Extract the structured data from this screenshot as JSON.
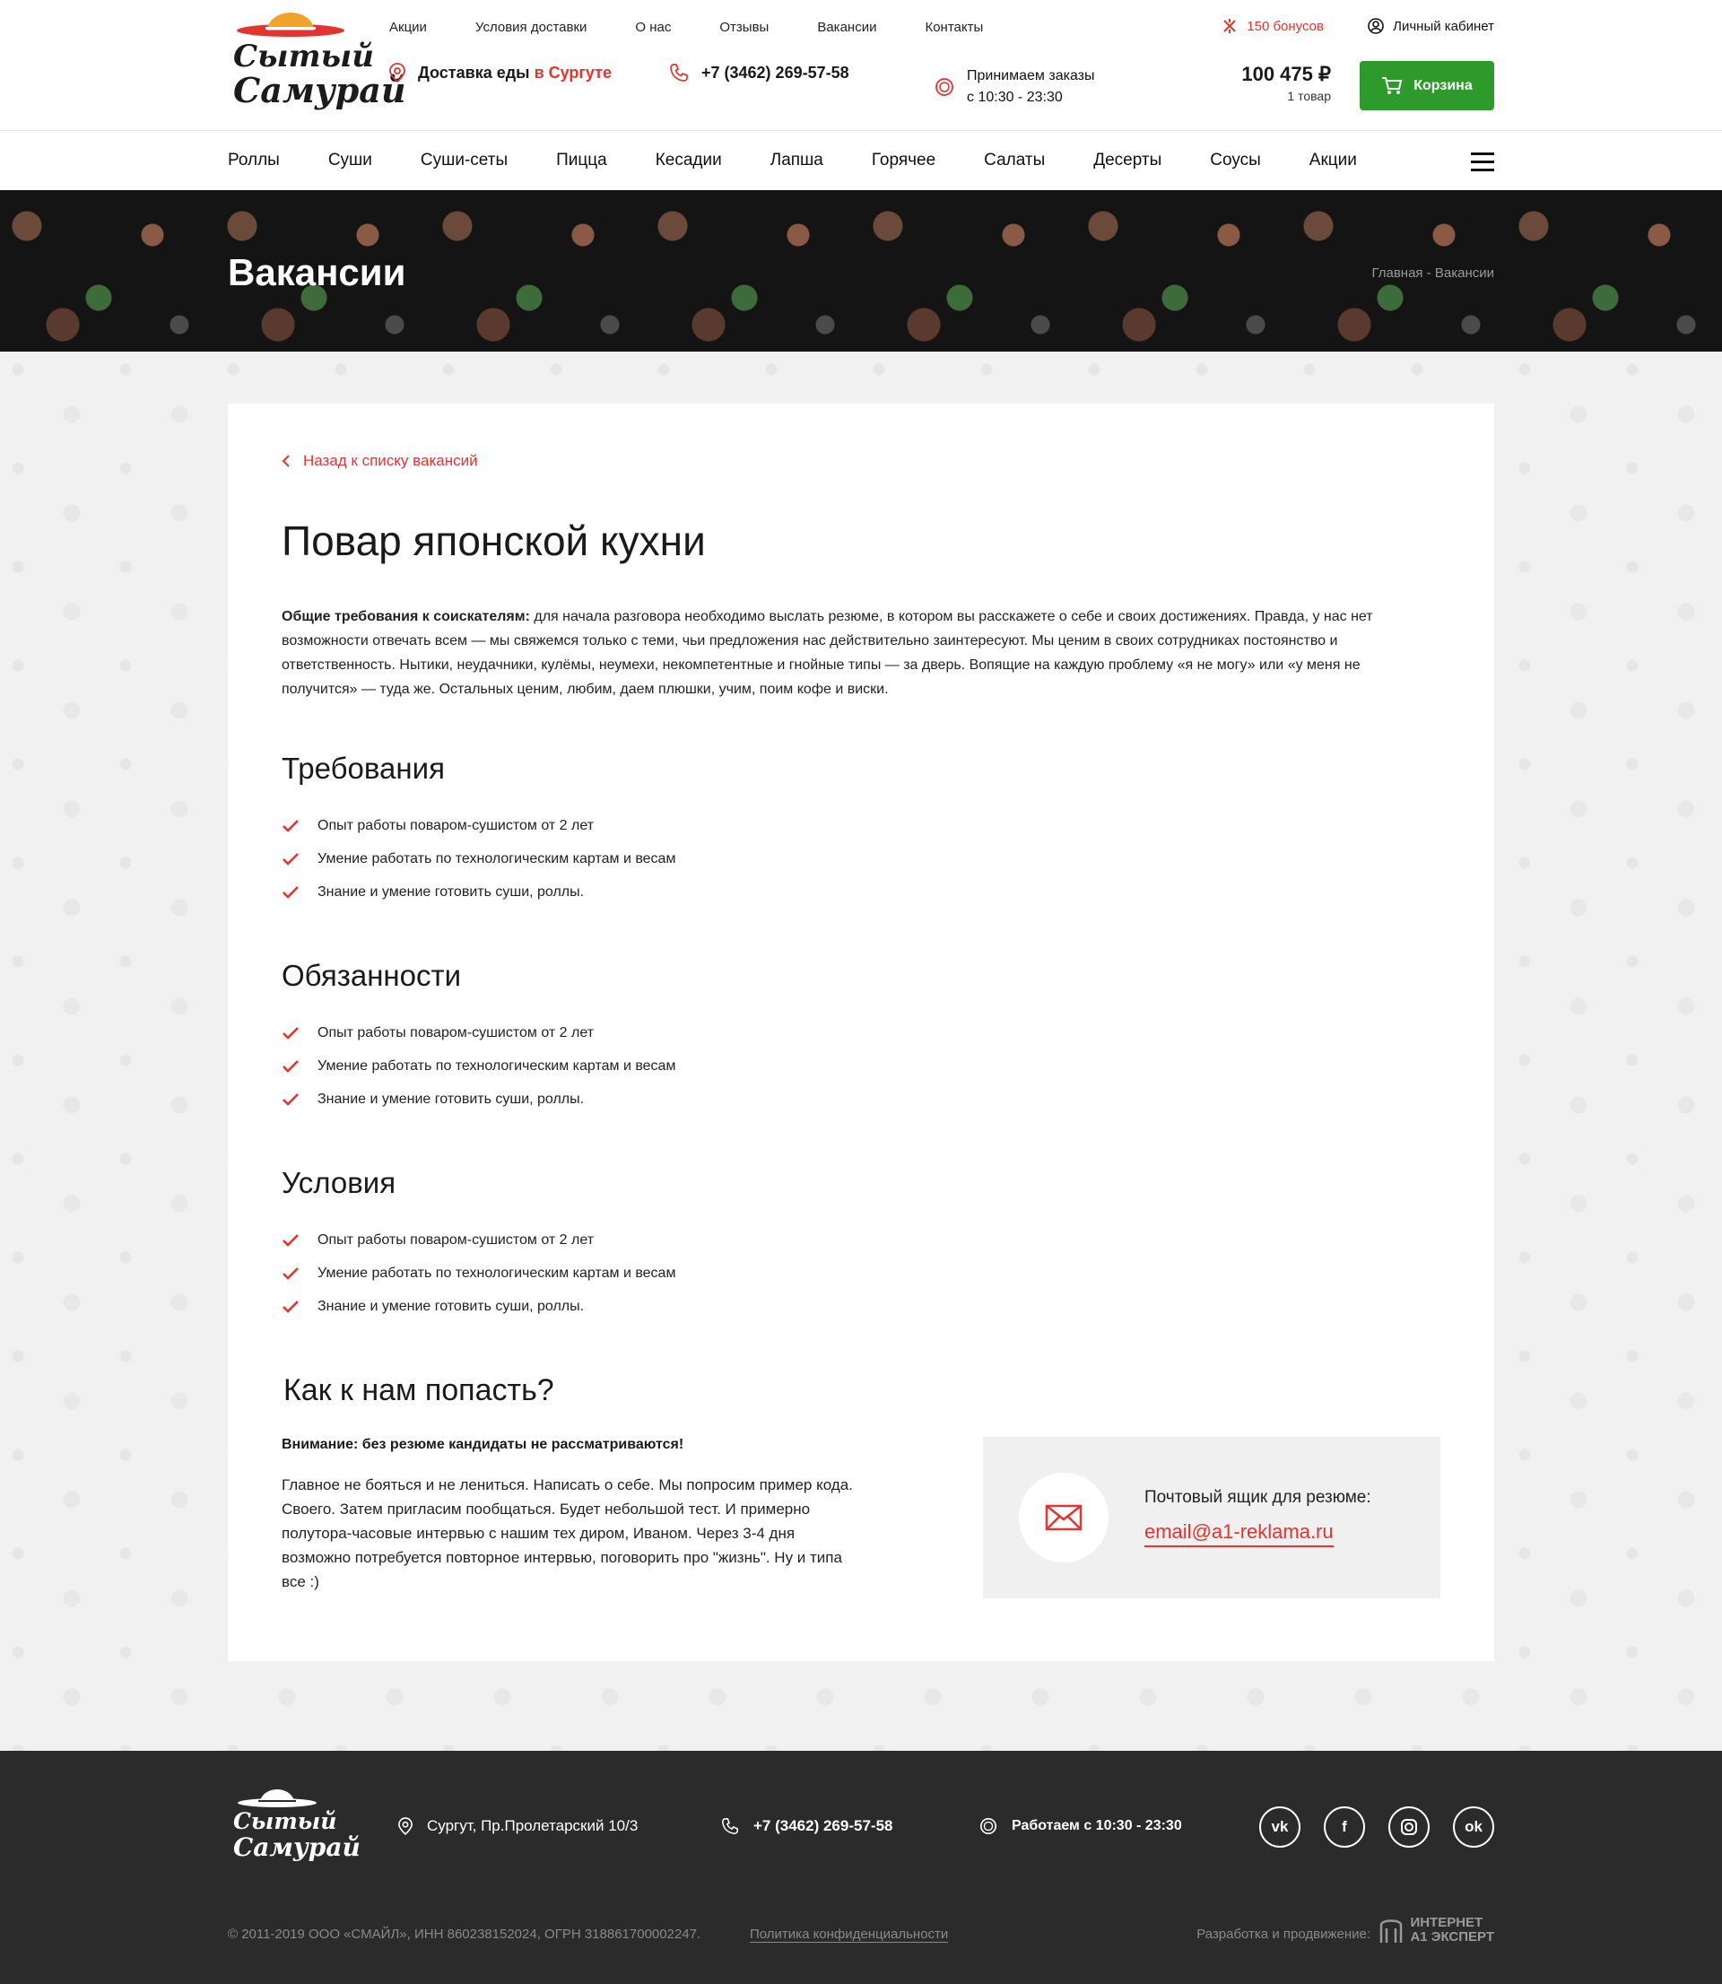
{
  "header": {
    "logo_line1": "Сытый",
    "logo_line2": "Самурай",
    "topnav": [
      "Акции",
      "Условия доставки",
      "О нас",
      "Отзывы",
      "Вакансии",
      "Контакты"
    ],
    "bonus": "150 бонусов",
    "cabinet": "Личный кабинет",
    "delivery_prefix": "Доставка еды",
    "delivery_city": "в Сургуте",
    "phone": "+7 (3462) 269-57-58",
    "hours_line1": "Принимаем заказы",
    "hours_line2": "с 10:30 - 23:30",
    "cart_total": "100 475 ₽",
    "cart_count": "1 товар",
    "cart_button": "Корзина"
  },
  "categories": [
    "Роллы",
    "Суши",
    "Суши-сеты",
    "Пицца",
    "Кесадии",
    "Лапша",
    "Горячее",
    "Салаты",
    "Десерты",
    "Соусы",
    "Акции"
  ],
  "banner": {
    "title": "Вакансии",
    "breadcrumb_home": "Главная",
    "breadcrumb_sep": "-",
    "breadcrumb_current": "Вакансии"
  },
  "vacancy": {
    "back_link": "Назад к списку вакансий",
    "title": "Повар японской кухни",
    "intro_bold": "Общие требования к соискателям:",
    "intro_text": " для начала разговора необходимо выслать резюме, в котором вы расскажете о себе и своих достижениях. Правда, у нас нет возможности отвечать всем — мы свяжемся только с теми, чьи предложения нас действительно заинтересуют. Мы ценим в своих сотрудниках постоянство и ответственность. Нытики, неудачники, кулёмы, неумехи,  некомпетентные и гнойные типы — за дверь. Вопящие на каждую проблему «я не могу» или «у меня не получится» — туда же. Остальных ценим, любим, даем плюшки, учим, поим кофе и виски.",
    "sections": [
      {
        "title": "Требования",
        "items": [
          "Опыт работы поваром-сушистом от 2 лет",
          "Умение работать по технологическим картам и весам",
          "Знание и умение готовить суши, роллы."
        ]
      },
      {
        "title": "Обязанности",
        "items": [
          "Опыт работы поваром-сушистом от 2 лет",
          "Умение работать по технологическим картам и весам",
          "Знание и умение готовить суши, роллы."
        ]
      },
      {
        "title": "Условия",
        "items": [
          "Опыт работы поваром-сушистом от 2 лет",
          "Умение работать по технологическим картам и весам",
          "Знание и умение готовить суши, роллы."
        ]
      }
    ],
    "how_title": "Как к нам попасть?",
    "warning": "Внимание: без резюме кандидаты не рассматриваются!",
    "how_text": "Главное не бояться и не лениться. Написать о себе. Мы попросим пример кода. Своего. Затем пригласим пообщаться. Будет небольшой тест. И примерно полутора-часовые интервью с нашим тех диром, Иваном. Через 3-4 дня возможно потребуется повторное интервью, поговорить про \"жизнь\". Ну и типа все :)",
    "mailbox_label": "Почтовый ящик для резюме:",
    "mailbox_email": "email@a1-reklama.ru"
  },
  "footer": {
    "address": "Сургут, Пр.Пролетарский 10/3",
    "phone": "+7 (3462) 269-57-58",
    "hours": "Работаем с 10:30 - 23:30",
    "socials": [
      "vk",
      "f",
      "ig",
      "ok"
    ],
    "copyright": "© 2011-2019  ООО «СМАЙЛ», ИНН 860238152024, ОГРН 318861700002247.",
    "privacy": "Политика конфиденциальности",
    "dev_label": "Разработка и продвижение:",
    "dev_logo_top": "ИНТЕРНЕТ",
    "dev_logo_bottom": "А1 ЭКСПЕРТ"
  },
  "colors": {
    "accent": "#e3342f",
    "cart": "#2d9a2b",
    "footer_bg": "#2b2b2b"
  }
}
